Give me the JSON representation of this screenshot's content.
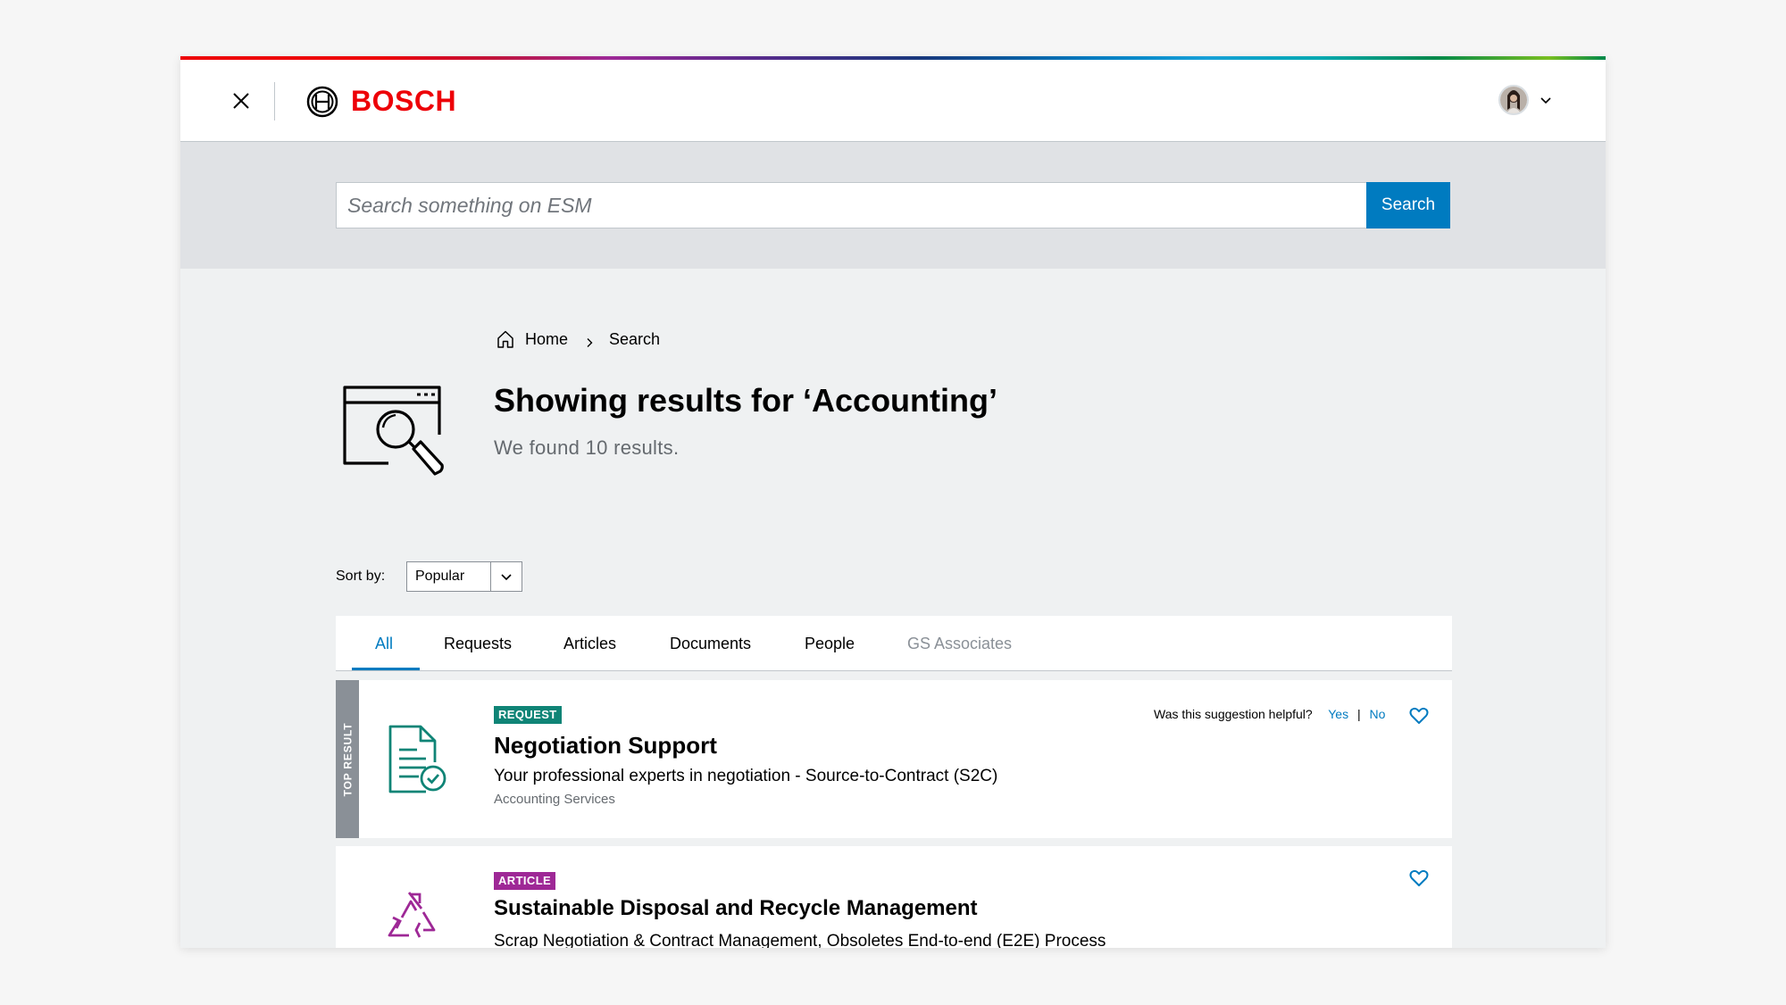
{
  "brand": {
    "name": "BOSCH",
    "color": "#ed0007"
  },
  "header": {
    "close_icon": "close-icon",
    "avatar_alt": "user-avatar"
  },
  "search": {
    "placeholder": "Search something on ESM",
    "button_label": "Search"
  },
  "breadcrumb": {
    "home": "Home",
    "current": "Search"
  },
  "results": {
    "title": "Showing results for ‘Accounting’",
    "subtitle": "We found 10 results."
  },
  "sort": {
    "label": "Sort by:",
    "selected": "Popular"
  },
  "tabs": [
    {
      "label": "All",
      "active": true
    },
    {
      "label": "Requests"
    },
    {
      "label": "Articles"
    },
    {
      "label": "Documents"
    },
    {
      "label": "People"
    },
    {
      "label": "GS Associates",
      "muted": true
    }
  ],
  "cards": [
    {
      "ribbon": "TOP RESULT",
      "badge": "REQUEST",
      "title": "Negotiation Support",
      "description": "Your professional experts in negotiation - Source-to-Contract (S2C)",
      "category": "Accounting Services",
      "helpful": {
        "question": "Was this suggestion helpful?",
        "yes": "Yes",
        "no": "No"
      },
      "icon": "document-check-icon"
    },
    {
      "badge": "ARTICLE",
      "title": "Sustainable Disposal and Recycle Management",
      "description": "Scrap Negotiation & Contract Management, Obsoletes End-to-end (E2E) Process",
      "icon": "recycle-icon"
    }
  ],
  "colors": {
    "accent": "#007bc0",
    "request_badge": "#0f8476",
    "article_badge": "#9e2896",
    "ribbon": "#8a9097"
  }
}
